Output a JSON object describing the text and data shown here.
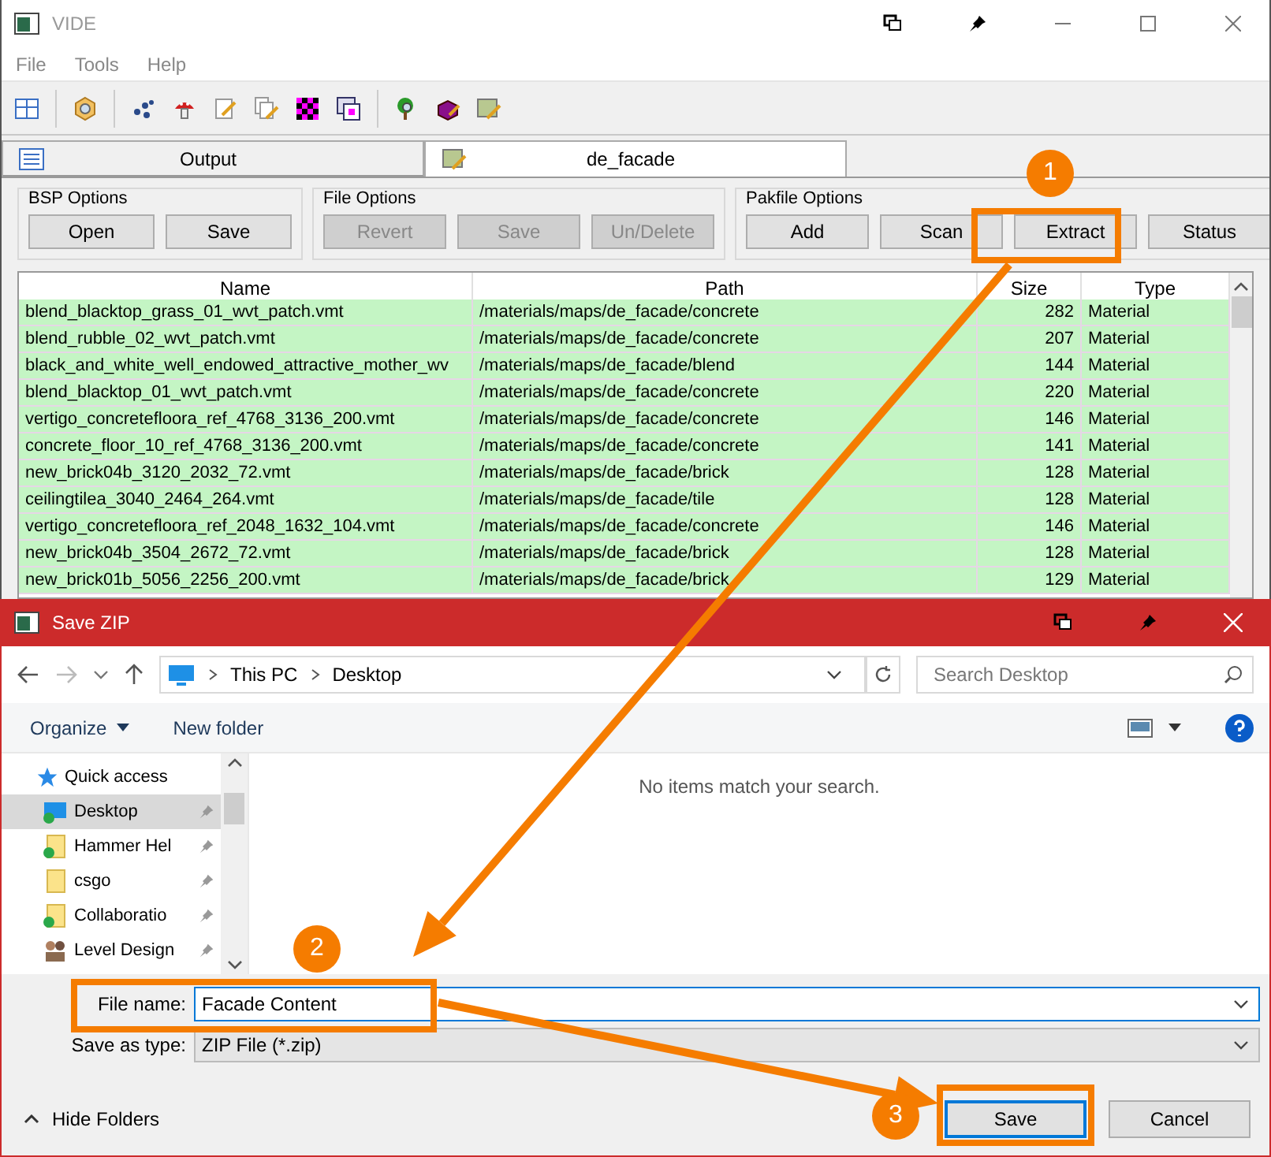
{
  "window": {
    "title": "VIDE"
  },
  "menu": [
    "File",
    "Tools",
    "Help"
  ],
  "tabs": [
    {
      "label": "Output",
      "selected": false
    },
    {
      "label": "de_facade",
      "selected": true
    }
  ],
  "groups": [
    {
      "title": "BSP Options",
      "buttons": [
        {
          "label": "Open",
          "disabled": false
        },
        {
          "label": "Save",
          "disabled": false
        }
      ]
    },
    {
      "title": "File Options",
      "buttons": [
        {
          "label": "Revert",
          "disabled": true
        },
        {
          "label": "Save",
          "disabled": true
        },
        {
          "label": "Un/Delete",
          "disabled": true
        }
      ]
    },
    {
      "title": "Pakfile Options",
      "buttons": [
        {
          "label": "Add",
          "disabled": false
        },
        {
          "label": "Scan",
          "disabled": false
        },
        {
          "label": "Extract",
          "disabled": false
        },
        {
          "label": "Status",
          "disabled": false
        }
      ]
    }
  ],
  "table": {
    "columns": [
      "Name",
      "Path",
      "Size",
      "Type"
    ],
    "rows": [
      [
        "blend_blacktop_grass_01_wvt_patch.vmt",
        "/materials/maps/de_facade/concrete",
        "282",
        "Material"
      ],
      [
        "blend_rubble_02_wvt_patch.vmt",
        "/materials/maps/de_facade/concrete",
        "207",
        "Material"
      ],
      [
        "black_and_white_well_endowed_attractive_mother_wv",
        "/materials/maps/de_facade/blend",
        "144",
        "Material"
      ],
      [
        "blend_blacktop_01_wvt_patch.vmt",
        "/materials/maps/de_facade/concrete",
        "220",
        "Material"
      ],
      [
        "vertigo_concretefloora_ref_4768_3136_200.vmt",
        "/materials/maps/de_facade/concrete",
        "146",
        "Material"
      ],
      [
        "concrete_floor_10_ref_4768_3136_200.vmt",
        "/materials/maps/de_facade/concrete",
        "141",
        "Material"
      ],
      [
        "new_brick04b_3120_2032_72.vmt",
        "/materials/maps/de_facade/brick",
        "128",
        "Material"
      ],
      [
        "ceilingtilea_3040_2464_264.vmt",
        "/materials/maps/de_facade/tile",
        "128",
        "Material"
      ],
      [
        "vertigo_concretefloora_ref_2048_1632_104.vmt",
        "/materials/maps/de_facade/concrete",
        "146",
        "Material"
      ],
      [
        "new_brick04b_3504_2672_72.vmt",
        "/materials/maps/de_facade/brick",
        "128",
        "Material"
      ],
      [
        "new_brick01b_5056_2256_200.vmt",
        "/materials/maps/de_facade/brick",
        "129",
        "Material"
      ]
    ]
  },
  "dialog": {
    "title": "Save ZIP",
    "breadcrumb": [
      "This PC",
      "Desktop"
    ],
    "search": {
      "placeholder": "Search Desktop"
    },
    "commands": [
      "Organize",
      "New folder"
    ],
    "nav": [
      {
        "label": "Quick access",
        "kind": "star",
        "selected": false,
        "synced": false
      },
      {
        "label": "Desktop",
        "kind": "desktop",
        "selected": true,
        "synced": true
      },
      {
        "label": "Hammer Hel",
        "kind": "folder",
        "selected": false,
        "synced": true
      },
      {
        "label": "csgo",
        "kind": "folder",
        "selected": false,
        "synced": false
      },
      {
        "label": "Collaboratio",
        "kind": "folder",
        "selected": false,
        "synced": true
      },
      {
        "label": "Level Design",
        "kind": "people",
        "selected": false,
        "synced": false
      }
    ],
    "empty_message": "No items match your search.",
    "file_name": {
      "label": "File name:",
      "value": "Facade Content"
    },
    "save_type": {
      "label": "Save as type:",
      "value": "ZIP File (*.zip)"
    },
    "hide_folders": "Hide Folders",
    "buttons": [
      "Save",
      "Cancel"
    ]
  },
  "annotations": [
    "1",
    "2",
    "3"
  ]
}
